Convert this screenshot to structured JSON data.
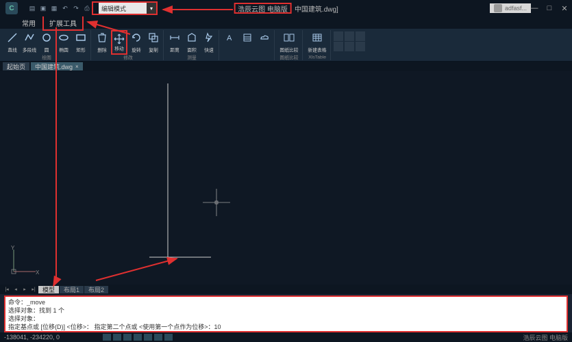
{
  "title": {
    "app_name": "浩辰云图 电脑版",
    "file": "中国建筑.dwg]",
    "search_text": "编辑模式",
    "user": "adfasf..."
  },
  "app_tabs": {
    "common": "常用",
    "extend": "扩展工具"
  },
  "ribbon": {
    "draw": {
      "line": "直线",
      "polyline": "多段线",
      "circle": "圆",
      "ellipse": "椭圆",
      "rect": "矩形",
      "group_label": "绘图"
    },
    "modify": {
      "delete": "删除",
      "move": "移动",
      "rotate": "旋转",
      "copy": "复制",
      "group_label": "修改"
    },
    "measure": {
      "distance": "距离",
      "area": "面积",
      "quick": "快速",
      "group_label": "测量"
    },
    "compare": {
      "compare": "图纸比较",
      "group_label": "图纸比较"
    },
    "table": {
      "new_table": "新建表格",
      "group_label": "XlsTable"
    }
  },
  "doc_tabs": {
    "start": "起始页",
    "file1": "中国建筑.dwg"
  },
  "layout": {
    "model": "模型",
    "l1": "布局1",
    "l2": "布局2"
  },
  "command": {
    "l1": "命令：_move",
    "l2": "选择对象：找到 1 个",
    "l3": "选择对象：",
    "l4": "指定基点或 [位移(D)] <位移>：  指定第二个点或 <使用第一个点作为位移>：10"
  },
  "status": {
    "coords": "-138041, -234220, 0",
    "right": "浩辰云图 电脑版"
  }
}
